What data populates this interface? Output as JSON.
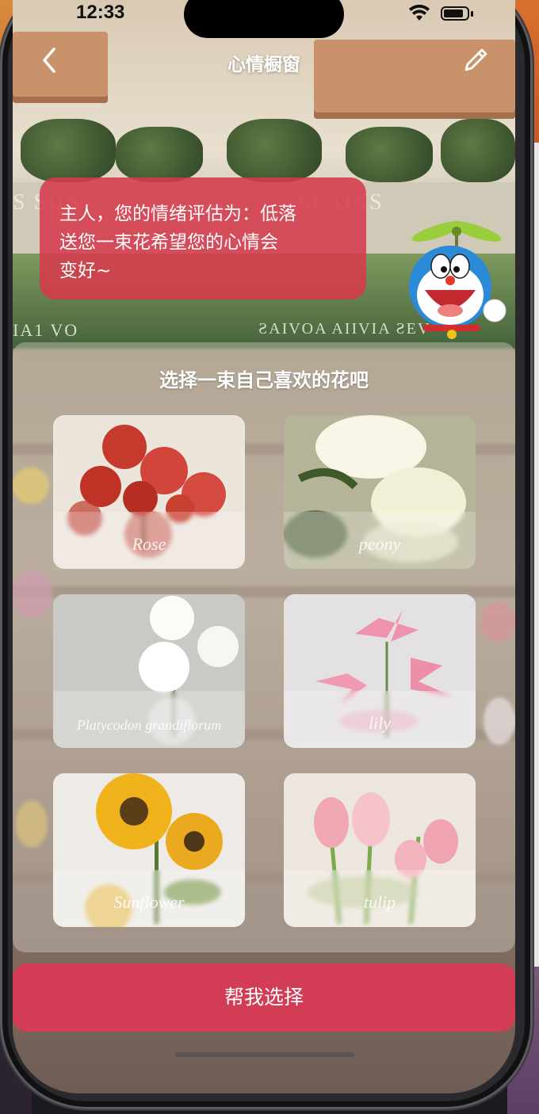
{
  "status": {
    "time": "12:33"
  },
  "nav": {
    "title": "心情橱窗",
    "back_icon": "chevron-left-icon",
    "edit_icon": "pencil-icon"
  },
  "bubble": {
    "line1": "主人，您的情绪评估为：低落",
    "line2": "送您一束花希望您的心情会",
    "line3": "变好~"
  },
  "background": {
    "sign_left": "S SUN",
    "sign_right": "SE ONS",
    "awning_left": "IA1 VO",
    "awning_right": "ƧAIVOA AIIVIA ƧEV"
  },
  "panel": {
    "title": "选择一束自己喜欢的花吧",
    "flowers": [
      {
        "name": "Rose"
      },
      {
        "name": "peony"
      },
      {
        "name": "Platycodon grandiflorum"
      },
      {
        "name": "lily"
      },
      {
        "name": "Sunflower"
      },
      {
        "name": "tulip"
      }
    ]
  },
  "actions": {
    "help_label": "帮我选择"
  },
  "colors": {
    "accent": "#d23d55",
    "bubble": "#d63a4c"
  }
}
